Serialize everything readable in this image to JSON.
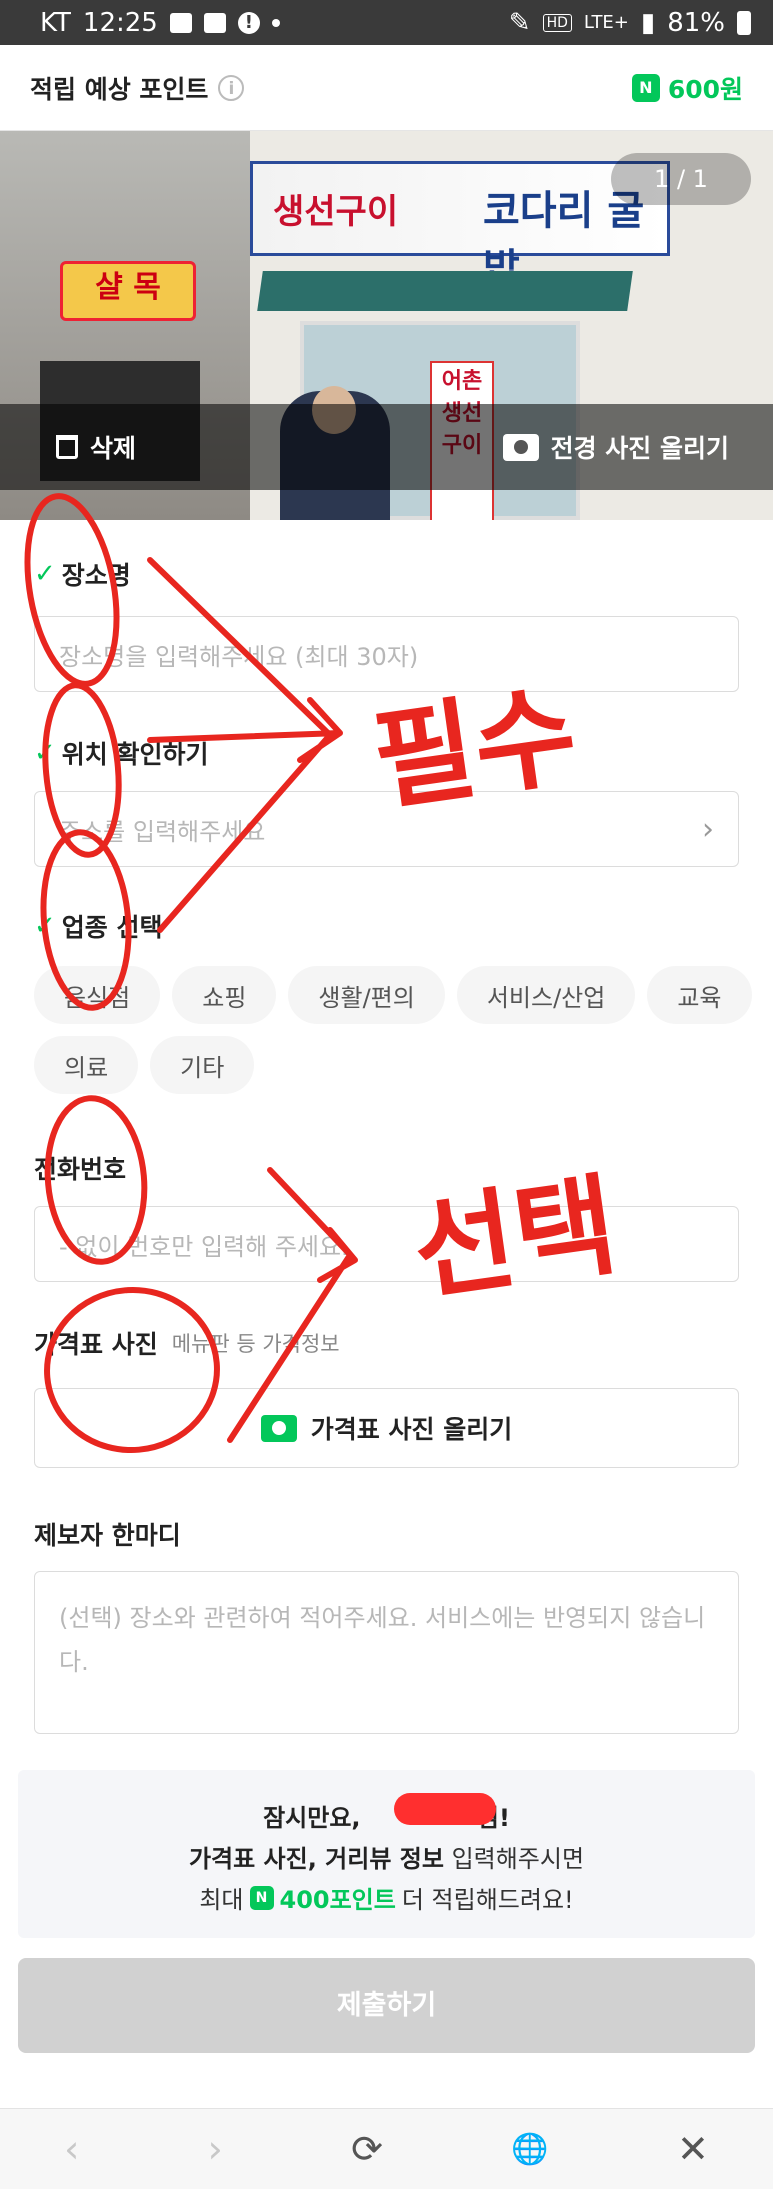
{
  "status_bar": {
    "carrier": "KT",
    "time": "12:25",
    "network": "LTE+",
    "battery": "81%",
    "hd": "HD"
  },
  "header": {
    "title": "적립 예상 포인트",
    "info_icon": "info-icon",
    "point_badge": "N",
    "points": "600원"
  },
  "photo": {
    "counter": "1 / 1",
    "delete_label": "삭제",
    "upload_label": "전경 사진 올리기",
    "scene_sign_left": "샬 목",
    "scene_sign_store": "생선구이",
    "scene_sign_store2": "코다리 굴밥",
    "scene_banner": "어촌 생선구이"
  },
  "form": {
    "place_name": {
      "label": "장소명",
      "placeholder": "장소명을 입력해주세요 (최대 30자)"
    },
    "location": {
      "label": "위치 확인하기",
      "placeholder": "주소를 입력해주세요"
    },
    "category": {
      "label": "업종 선택",
      "chips": [
        "음식점",
        "쇼핑",
        "생활/편의",
        "서비스/산업",
        "교육",
        "의료",
        "기타"
      ]
    },
    "phone": {
      "label": "전화번호",
      "placeholder": "- 없이 번호만 입력해 주세요."
    },
    "price_photo": {
      "label": "가격표 사진",
      "sub": "메뉴판 등 가격정보",
      "button": "가격표 사진 올리기"
    },
    "comment": {
      "label": "제보자 한마디",
      "placeholder": "(선택) 장소와 관련하여 적어주세요. 서비스에는 반영되지 않습니다."
    }
  },
  "promo": {
    "line1": "잠시만요,",
    "line1_end": "님!",
    "line2_bold": "가격표 사진, 거리뷰 정보",
    "line2_rest": " 입력해주시면",
    "line3_pre": "최대",
    "line3_badge": "N",
    "line3_points": "400포인트",
    "line3_post": "더 적립해드려요!"
  },
  "submit_label": "제출하기",
  "bottom_nav": {
    "back": "‹",
    "forward": "›",
    "refresh": "⟳",
    "globe": "🌐",
    "close": "✕"
  },
  "annotations": {
    "required_note": "필수",
    "optional_note": "선택"
  },
  "colors": {
    "accent": "#03c75a",
    "annotation": "#e8261f"
  }
}
